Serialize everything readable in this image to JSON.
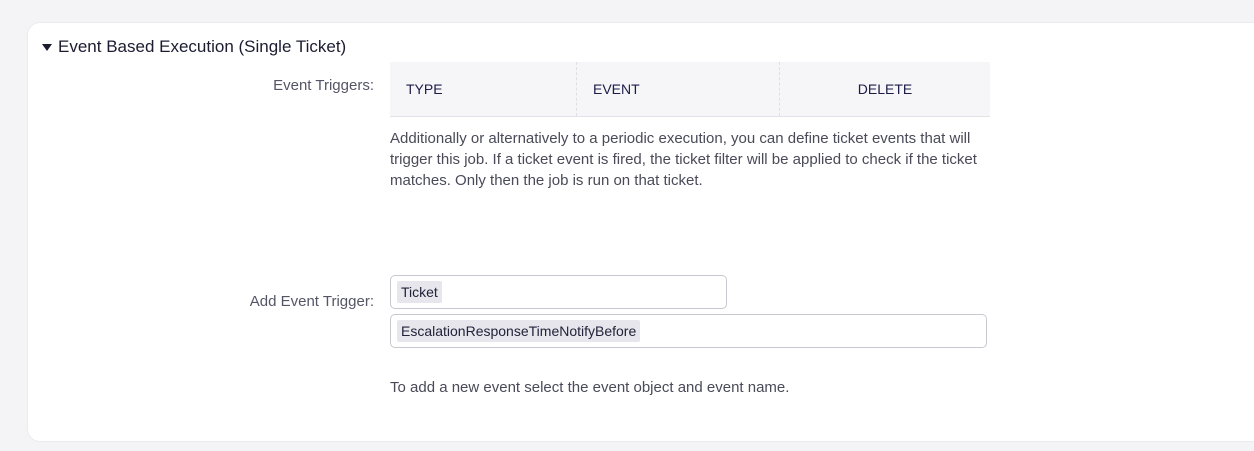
{
  "panel": {
    "title": "Event Based Execution (Single Ticket)"
  },
  "event_triggers": {
    "label": "Event Triggers:",
    "columns": [
      "TYPE",
      "EVENT",
      "DELETE"
    ],
    "help": "Additionally or alternatively to a periodic execution, you can define ticket events that will trigger this job. If a ticket event is fired, the ticket filter will be applied to check if the ticket matches. Only then the job is run on that ticket."
  },
  "add_event_trigger": {
    "label": "Add Event Trigger:",
    "event_object_value": "Ticket",
    "event_name_value": "EscalationResponseTimeNotifyBefore",
    "help": "To add a new event select the event object and event name."
  },
  "icons": {
    "collapse": "caret-down-icon"
  },
  "colors": {
    "table_header_bg": "#f6f6f8",
    "chip_bg": "#e6e6ec"
  }
}
